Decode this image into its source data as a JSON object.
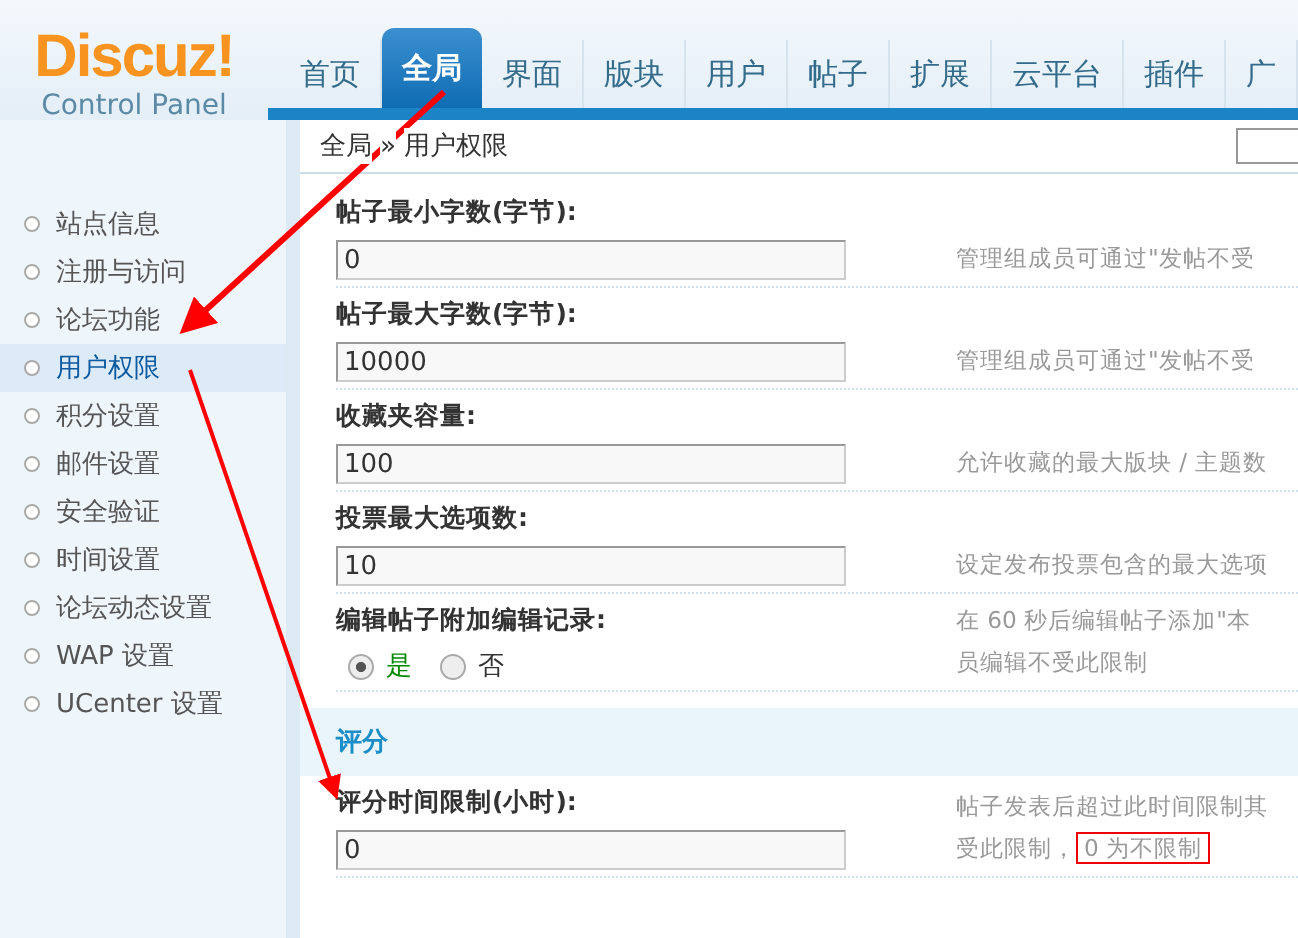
{
  "logo": {
    "brand": "Discuz!",
    "subtitle": "Control Panel"
  },
  "nav": [
    {
      "label": "首页",
      "selected": false
    },
    {
      "label": "全局",
      "selected": true
    },
    {
      "label": "界面",
      "selected": false
    },
    {
      "label": "版块",
      "selected": false
    },
    {
      "label": "用户",
      "selected": false
    },
    {
      "label": "帖子",
      "selected": false
    },
    {
      "label": "扩展",
      "selected": false
    },
    {
      "label": "云平台",
      "selected": false
    },
    {
      "label": "插件",
      "selected": false
    },
    {
      "label": "广",
      "selected": false
    }
  ],
  "breadcrumb": {
    "parent": "全局",
    "separator": "»",
    "current": "用户权限"
  },
  "sidebar": {
    "items": [
      {
        "label": "站点信息",
        "selected": false
      },
      {
        "label": "注册与访问",
        "selected": false
      },
      {
        "label": "论坛功能",
        "selected": false
      },
      {
        "label": "用户权限",
        "selected": true
      },
      {
        "label": "积分设置",
        "selected": false
      },
      {
        "label": "邮件设置",
        "selected": false
      },
      {
        "label": "安全验证",
        "selected": false
      },
      {
        "label": "时间设置",
        "selected": false
      },
      {
        "label": "论坛动态设置",
        "selected": false
      },
      {
        "label": "WAP 设置",
        "selected": false
      },
      {
        "label": "UCenter 设置",
        "selected": false
      }
    ]
  },
  "settings": [
    {
      "kind": "text",
      "label": "帖子最小字数(字节):",
      "value": "0",
      "description": [
        "管理组成员可通过\"发帖不受"
      ]
    },
    {
      "kind": "text",
      "label": "帖子最大字数(字节):",
      "value": "10000",
      "description": [
        "管理组成员可通过\"发帖不受"
      ]
    },
    {
      "kind": "text",
      "label": "收藏夹容量:",
      "value": "100",
      "description": [
        "允许收藏的最大版块 / 主题数"
      ]
    },
    {
      "kind": "text",
      "label": "投票最大选项数:",
      "value": "10",
      "description": [
        "设定发布投票包含的最大选项"
      ]
    },
    {
      "kind": "radio",
      "label": "编辑帖子附加编辑记录:",
      "options": [
        {
          "label": "是",
          "selected": true
        },
        {
          "label": "否",
          "selected": false
        }
      ],
      "description": [
        "在 60 秒后编辑帖子添加\"本",
        "员编辑不受此限制"
      ]
    },
    {
      "kind": "section",
      "label": "评分"
    },
    {
      "kind": "text",
      "label": "评分时间限制(小时):",
      "value": "0",
      "description": [
        "帖子发表后超过此时间限制其",
        "受此限制，"
      ],
      "highlight": "0 为不限制"
    }
  ]
}
